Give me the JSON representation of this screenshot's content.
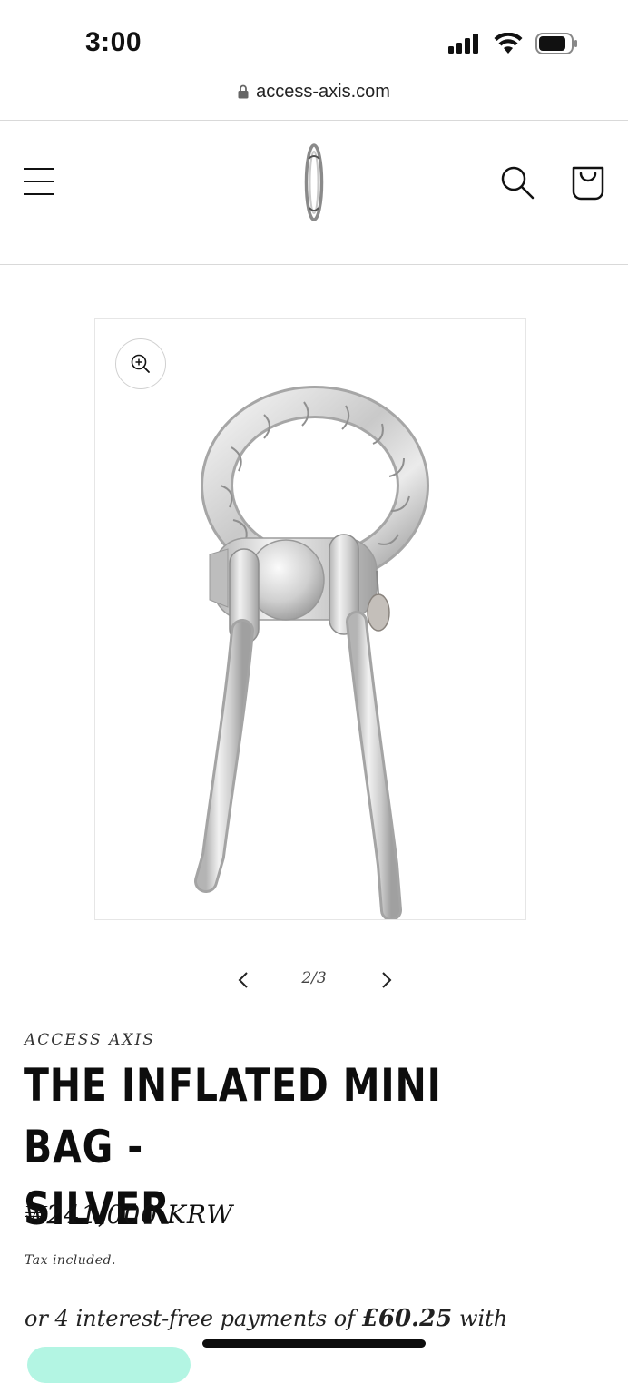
{
  "status": {
    "time": "3:00",
    "icons": [
      "signal-icon",
      "wifi-icon",
      "battery-icon"
    ]
  },
  "browser": {
    "url": "access-axis.com",
    "lock_icon": "lock-icon"
  },
  "header": {
    "menu_icon": "hamburger-menu-icon",
    "logo": "access-axis-logo",
    "search_icon": "search-icon",
    "cart_icon": "cart-icon"
  },
  "gallery": {
    "zoom_icon": "zoom-in-icon",
    "image": "silver-inflated-mini-bag",
    "current": 2,
    "total": 3,
    "counter": "2/3"
  },
  "product": {
    "vendor": "ACCESS AXIS",
    "title_line1": "THE INFLATED MINI BAG -",
    "title_line2": "SILVER",
    "price": "₩241,000 KRW",
    "tax_note": "Tax included.",
    "installments_prefix": "or 4 interest-free payments of",
    "installments_amount": "£60.25",
    "installments_suffix": "with"
  },
  "colors": {
    "pay_button": "#b3f5e3",
    "text": "#111111"
  }
}
